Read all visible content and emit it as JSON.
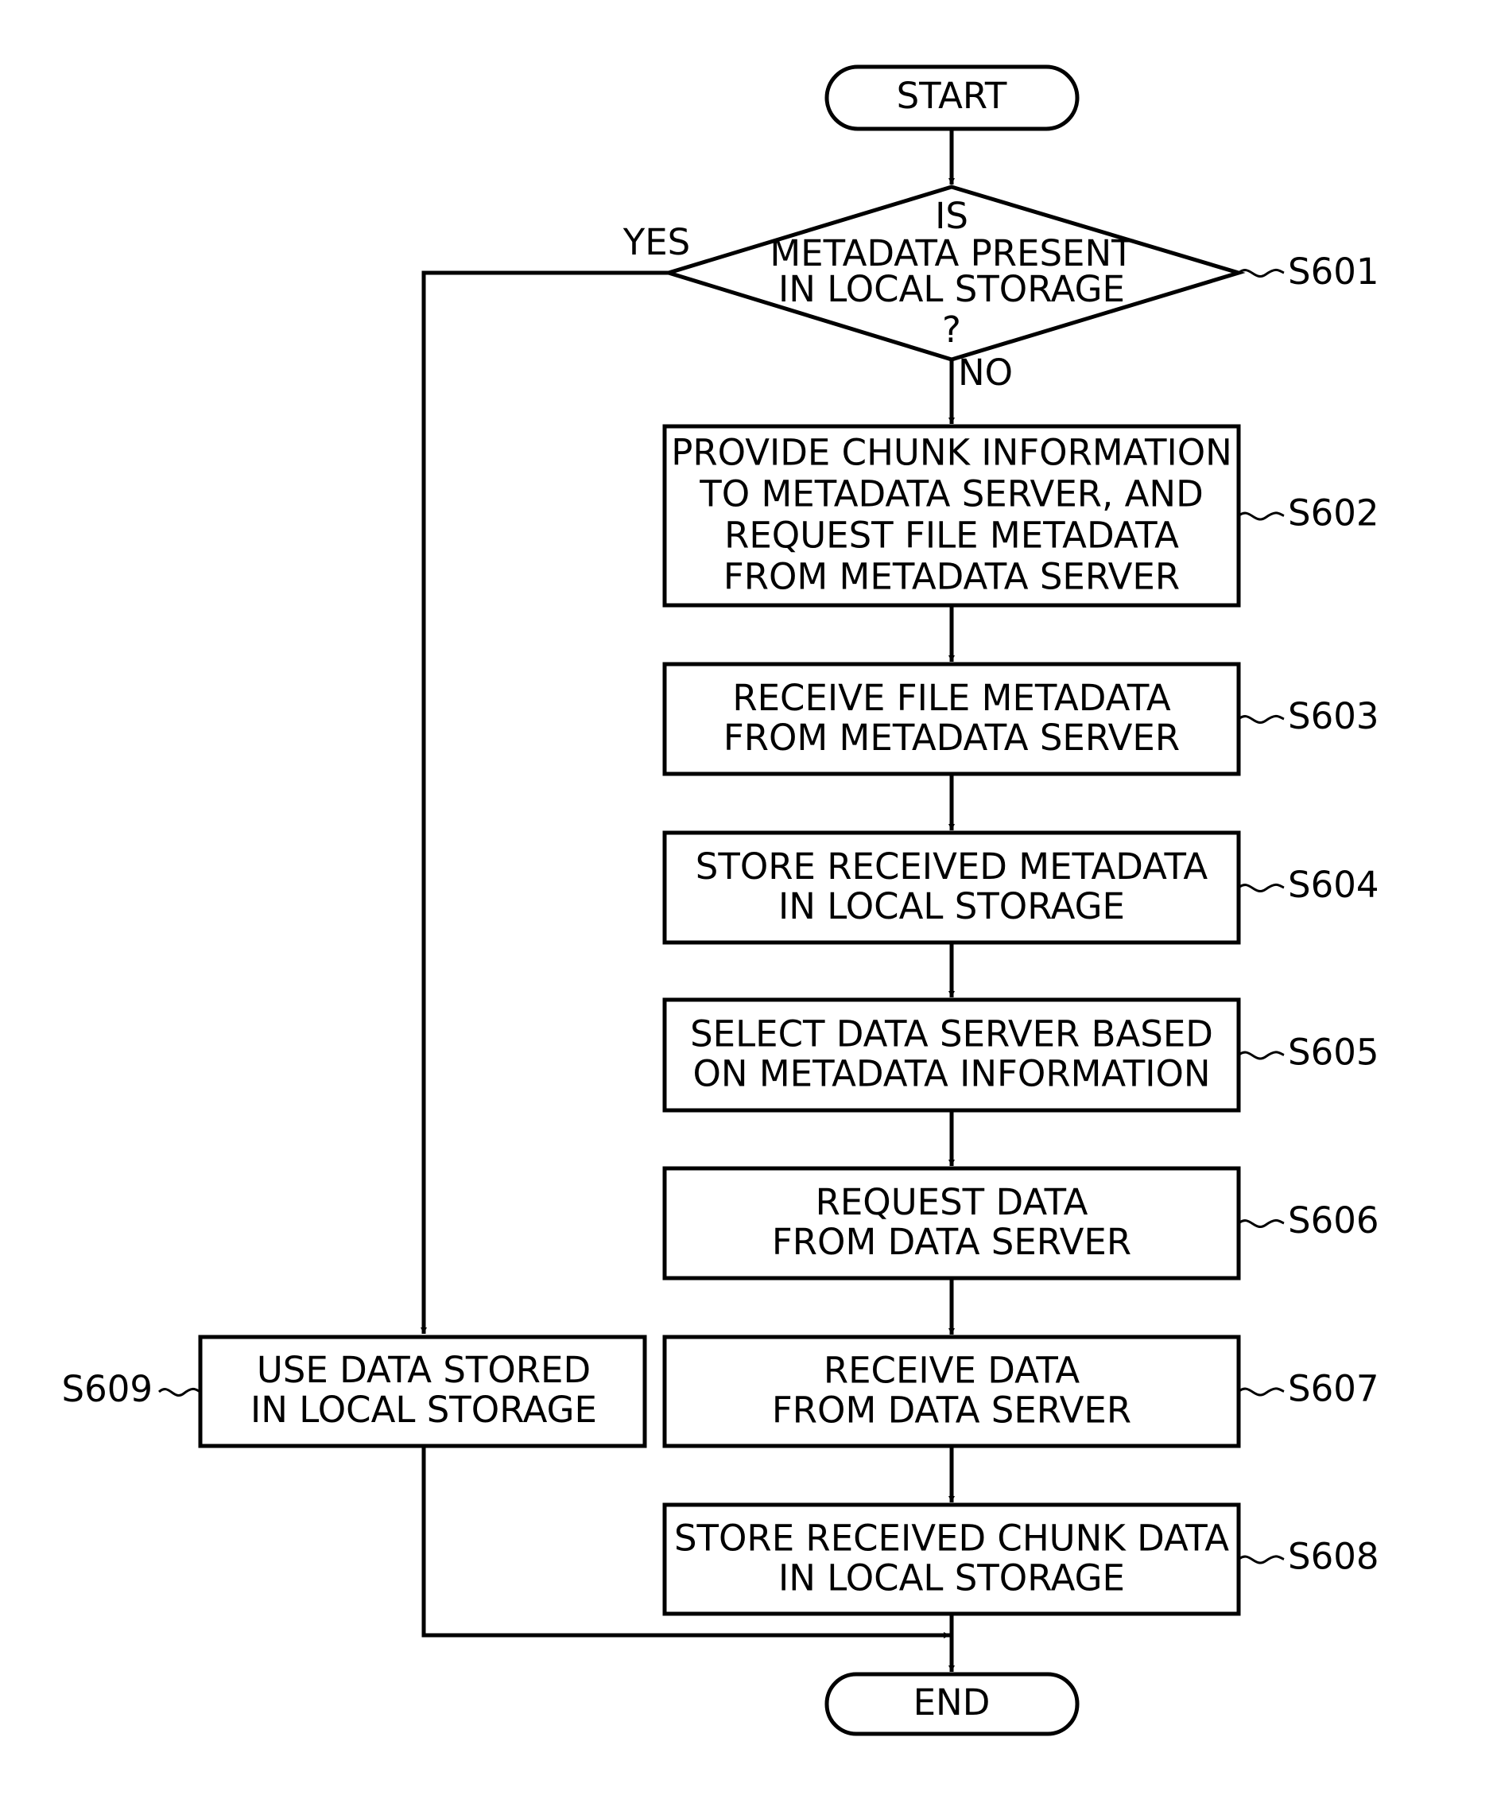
{
  "flowchart": {
    "start": {
      "label": "START"
    },
    "end": {
      "label": "END"
    },
    "decision": {
      "id": "S601",
      "lines": [
        "IS",
        "METADATA PRESENT",
        "IN LOCAL STORAGE",
        "?"
      ],
      "yes_label": "YES",
      "no_label": "NO"
    },
    "steps": [
      {
        "id": "S602",
        "lines": [
          "PROVIDE CHUNK INFORMATION",
          "TO METADATA SERVER, AND",
          "REQUEST FILE METADATA",
          "FROM METADATA SERVER"
        ]
      },
      {
        "id": "S603",
        "lines": [
          "RECEIVE FILE METADATA",
          "FROM METADATA SERVER"
        ]
      },
      {
        "id": "S604",
        "lines": [
          "STORE RECEIVED METADATA",
          "IN LOCAL STORAGE"
        ]
      },
      {
        "id": "S605",
        "lines": [
          "SELECT DATA SERVER BASED",
          "ON METADATA INFORMATION"
        ]
      },
      {
        "id": "S606",
        "lines": [
          "REQUEST DATA",
          "FROM DATA SERVER"
        ]
      },
      {
        "id": "S607",
        "lines": [
          "RECEIVE DATA",
          "FROM DATA SERVER"
        ]
      },
      {
        "id": "S608",
        "lines": [
          "STORE RECEIVED CHUNK DATA",
          "IN LOCAL STORAGE"
        ]
      }
    ],
    "side_step": {
      "id": "S609",
      "lines": [
        "USE DATA STORED",
        "IN LOCAL STORAGE"
      ]
    }
  }
}
